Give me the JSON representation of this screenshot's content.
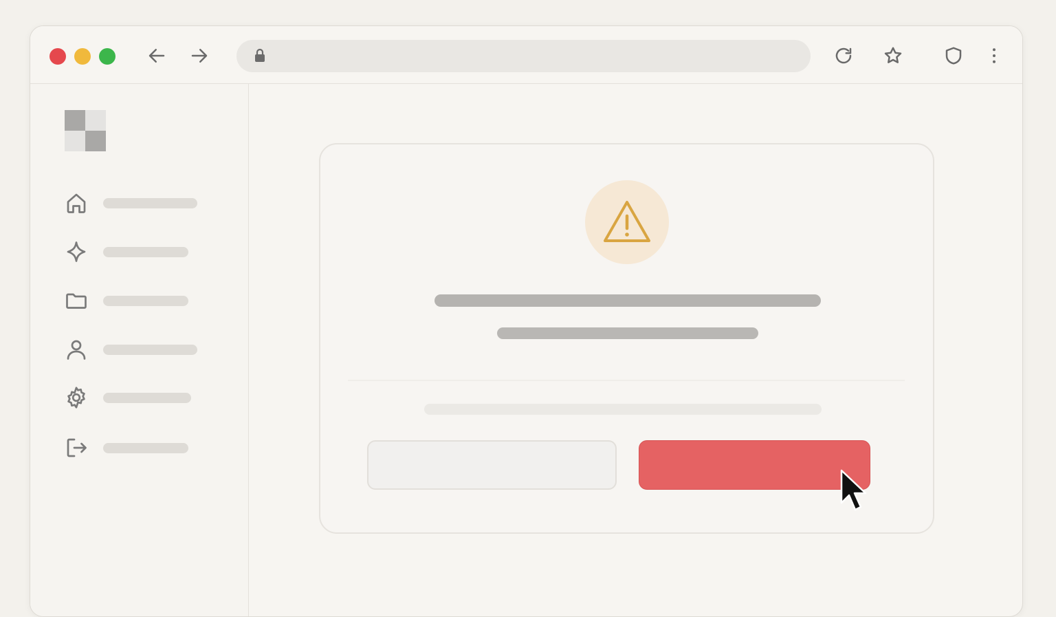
{
  "browser": {
    "traffic_lights": {
      "close": "#e5484d",
      "minimize": "#f0b93c",
      "maximize": "#3cb64b"
    },
    "address_bar": {
      "url": "",
      "placeholder": ""
    },
    "icons": [
      "back-arrow-icon",
      "forward-arrow-icon",
      "lock-icon",
      "reload-icon",
      "star-icon",
      "shield-icon",
      "kebab-menu-icon"
    ]
  },
  "sidebar": {
    "logo_colors": [
      "#a9a8a6",
      "#e4e3e1",
      "#e4e3e1",
      "#a9a8a6"
    ],
    "items": [
      {
        "icon": "home-icon",
        "label": ""
      },
      {
        "icon": "sparkle-icon",
        "label": ""
      },
      {
        "icon": "folder-icon",
        "label": ""
      },
      {
        "icon": "user-icon",
        "label": ""
      },
      {
        "icon": "gear-icon",
        "label": ""
      },
      {
        "icon": "logout-icon",
        "label": ""
      }
    ]
  },
  "dialog": {
    "icon": "warning-icon",
    "accent_color": "#d9a541",
    "title": "",
    "message": "",
    "hint": "",
    "cancel_label": "",
    "confirm_label": "",
    "confirm_color": "#e56263"
  }
}
